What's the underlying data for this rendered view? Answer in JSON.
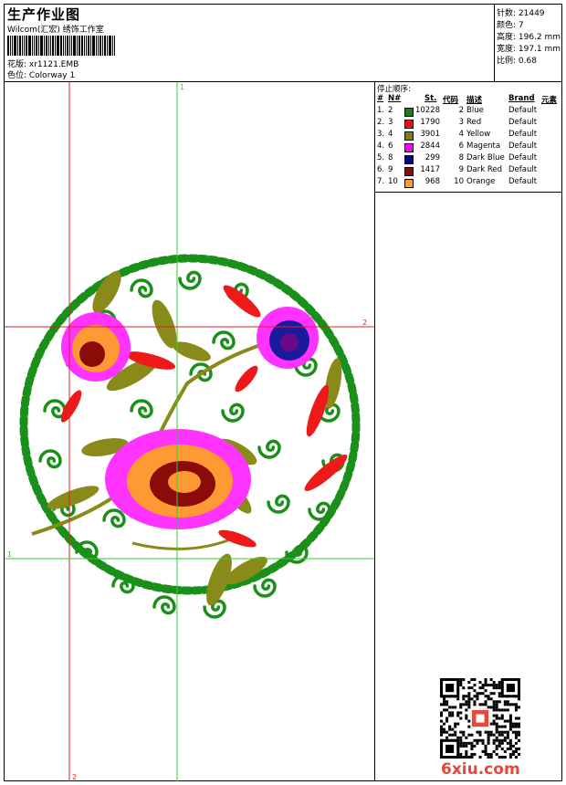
{
  "header": {
    "title": "生产作业图",
    "company": "Wilcom(汇宏) 绣饰工作室",
    "design_label": "花版: xr1121.EMB",
    "colorway_label": "色位:  Colorway 1",
    "stats": [
      {
        "label": "针数: 21449"
      },
      {
        "label": "颜色: 7"
      },
      {
        "label": "高度: 196.2 mm"
      },
      {
        "label": "宽度: 197.1 mm"
      },
      {
        "label": "比例: 0.68"
      }
    ]
  },
  "panel": {
    "title": "停止顺序:",
    "columns": {
      "num": "#",
      "no": "N#",
      "st": "St.",
      "code": "代码",
      "desc": "描述",
      "brand": "Brand",
      "elem": "元素"
    },
    "rows": [
      {
        "num": "1.",
        "no": "2",
        "color": "#1a7f1a",
        "st": "10228",
        "code": "2",
        "desc": "Blue",
        "brand": "Default"
      },
      {
        "num": "2.",
        "no": "3",
        "color": "#ee1111",
        "st": "1790",
        "code": "3",
        "desc": "Red",
        "brand": "Default"
      },
      {
        "num": "3.",
        "no": "4",
        "color": "#7f7f1a",
        "st": "3901",
        "code": "4",
        "desc": "Yellow",
        "brand": "Default"
      },
      {
        "num": "4.",
        "no": "6",
        "color": "#ff00ff",
        "st": "2844",
        "code": "6",
        "desc": "Magenta",
        "brand": "Default"
      },
      {
        "num": "5.",
        "no": "8",
        "color": "#00008b",
        "st": "299",
        "code": "8",
        "desc": "Dark Blue",
        "brand": "Default"
      },
      {
        "num": "6.",
        "no": "9",
        "color": "#8b0a0a",
        "st": "1417",
        "code": "9",
        "desc": "Dark Red",
        "brand": "Default"
      },
      {
        "num": "7.",
        "no": "10",
        "color": "#ff9933",
        "st": "968",
        "code": "10",
        "desc": "Orange",
        "brand": "Default"
      }
    ]
  },
  "guides": {
    "v1_label": "1",
    "v2_label": "2",
    "h1_label": "1",
    "h2_label": "2",
    "green": "#33cc33",
    "red": "#dd2222"
  },
  "watermark": "6xiu.com"
}
